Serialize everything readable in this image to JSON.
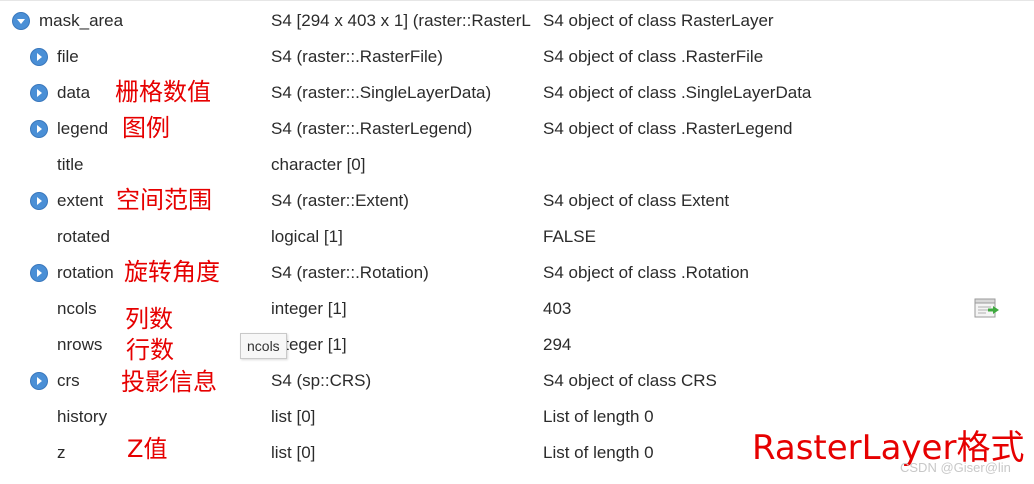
{
  "icons": {
    "collapse": "collapse-arrow-icon",
    "expand": "expand-arrow-icon",
    "view_data": "view-data-icon",
    "accent": "#4a8fd6"
  },
  "rows": [
    {
      "name": "mask_area",
      "type": "S4 [294 x 403 x 1] (raster::RasterL",
      "value": "S4 object of class RasterLayer",
      "toggle": "collapse"
    },
    {
      "name": "file",
      "type": "S4 (raster::.RasterFile)",
      "value": "S4 object of class .RasterFile",
      "toggle": "expand"
    },
    {
      "name": "data",
      "type": "S4 (raster::.SingleLayerData)",
      "value": "S4 object of class .SingleLayerData",
      "toggle": "expand"
    },
    {
      "name": "legend",
      "type": "S4 (raster::.RasterLegend)",
      "value": "S4 object of class .RasterLegend",
      "toggle": "expand"
    },
    {
      "name": "title",
      "type": "character [0]",
      "value": "",
      "toggle": ""
    },
    {
      "name": "extent",
      "type": "S4 (raster::Extent)",
      "value": "S4 object of class Extent",
      "toggle": "expand"
    },
    {
      "name": "rotated",
      "type": "logical [1]",
      "value": "FALSE",
      "toggle": ""
    },
    {
      "name": "rotation",
      "type": "S4 (raster::.Rotation)",
      "value": "S4 object of class .Rotation",
      "toggle": "expand"
    },
    {
      "name": "ncols",
      "type": "integer [1]",
      "value": "403",
      "toggle": ""
    },
    {
      "name": "nrows",
      "type": "integer [1]",
      "value": "294",
      "toggle": ""
    },
    {
      "name": "crs",
      "type": "S4 (sp::CRS)",
      "value": "S4 object of class CRS",
      "toggle": "expand"
    },
    {
      "name": "history",
      "type": "list [0]",
      "value": "List of length 0",
      "toggle": ""
    },
    {
      "name": "z",
      "type": "list [0]",
      "value": "List of length 0",
      "toggle": ""
    }
  ],
  "annotations": {
    "data": "栅格数值",
    "legend": "图例",
    "extent": "空间范围",
    "rotation": "旋转角度",
    "ncols": "列数",
    "nrows": "行数",
    "crs": "投影信息",
    "z": "Z值",
    "title": "RasterLayer格式",
    "color": "#e60000"
  },
  "tooltip": "ncols",
  "watermark": "CSDN @Giser@lin"
}
